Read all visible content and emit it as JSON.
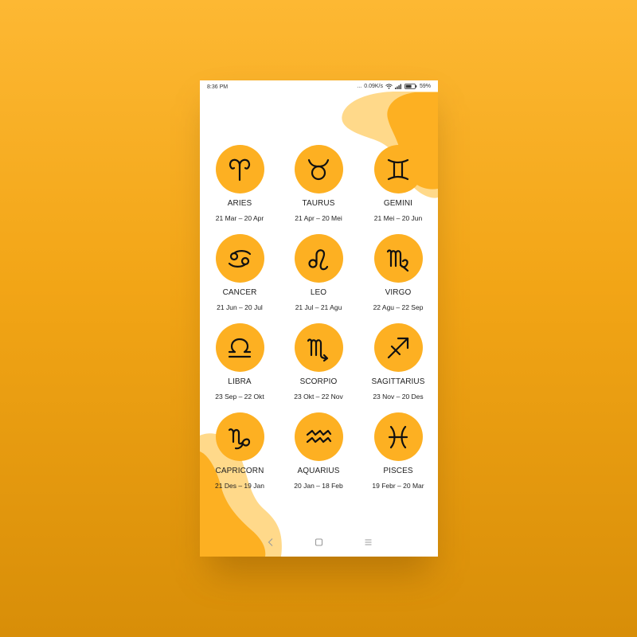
{
  "status": {
    "time": "8:36 PM",
    "dots": "...",
    "speed": "0.09K/s",
    "battery": "59%"
  },
  "signs": [
    {
      "name": "ARIES",
      "dates": "21 Mar – 20 Apr",
      "icon": "aries-icon"
    },
    {
      "name": "TAURUS",
      "dates": "21 Apr – 20 Mei",
      "icon": "taurus-icon"
    },
    {
      "name": "GEMINI",
      "dates": "21 Mei – 20 Jun",
      "icon": "gemini-icon"
    },
    {
      "name": "CANCER",
      "dates": "21 Jun – 20 Jul",
      "icon": "cancer-icon"
    },
    {
      "name": "LEO",
      "dates": "21 Jul – 21 Agu",
      "icon": "leo-icon"
    },
    {
      "name": "VIRGO",
      "dates": "22 Agu – 22 Sep",
      "icon": "virgo-icon"
    },
    {
      "name": "LIBRA",
      "dates": "23 Sep – 22 Okt",
      "icon": "libra-icon"
    },
    {
      "name": "SCORPIO",
      "dates": "23 Okt – 22 Nov",
      "icon": "scorpio-icon"
    },
    {
      "name": "SAGITTARIUS",
      "dates": "23 Nov – 20 Des",
      "icon": "sagittarius-icon"
    },
    {
      "name": "CAPRICORN",
      "dates": "21 Des – 19 Jan",
      "icon": "capricorn-icon"
    },
    {
      "name": "AQUARIUS",
      "dates": "20 Jan – 18 Feb",
      "icon": "aquarius-icon"
    },
    {
      "name": "PISCES",
      "dates": "19 Febr – 20 Mar",
      "icon": "pisces-icon"
    }
  ],
  "nav": [
    "back-icon",
    "home-icon",
    "menu-icon"
  ],
  "colors": {
    "accent": "#FDB022",
    "accent_light": "#FFD98A",
    "background": "#F2A516"
  }
}
